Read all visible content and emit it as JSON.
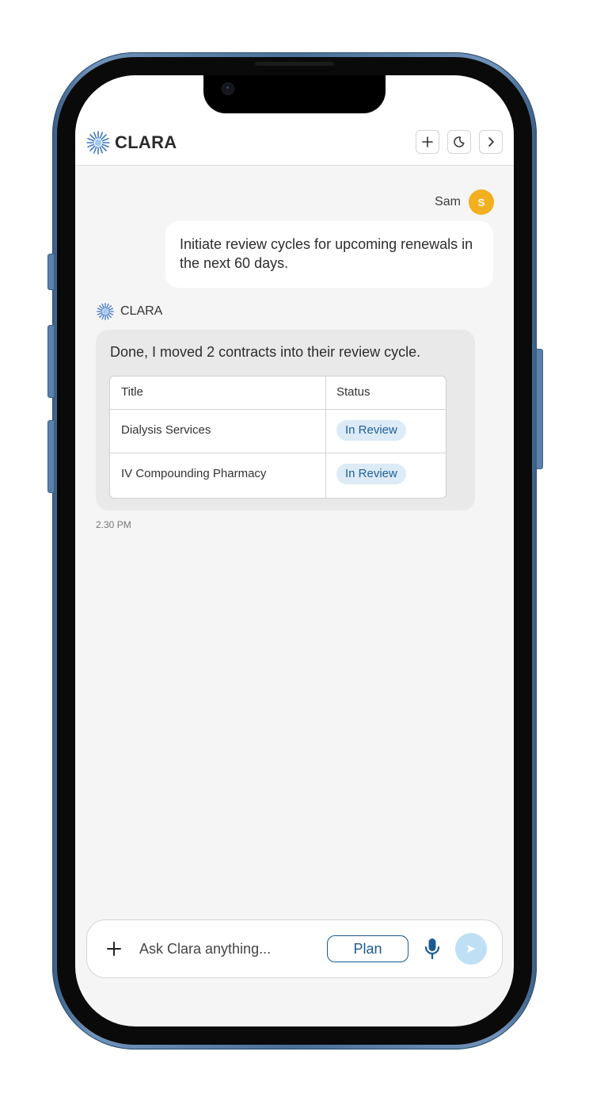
{
  "header": {
    "brand": "CLARA",
    "buttons": {
      "new_chat_icon": "plus-icon",
      "theme_icon": "moon-icon",
      "collapse_icon": "chevron-right-icon"
    }
  },
  "conversation": {
    "user": {
      "name": "Sam",
      "avatar_initial": "S",
      "avatar_color": "#F2B01E",
      "message": "Initiate review cycles for upcoming renewals in the next 60 days."
    },
    "assistant": {
      "name": "CLARA",
      "message": "Done, I moved 2 contracts into their review cycle.",
      "table": {
        "columns": [
          "Title",
          "Status"
        ],
        "rows": [
          {
            "title": "Dialysis Services",
            "status": "In Review"
          },
          {
            "title": "IV Compounding Pharmacy",
            "status": "In Review"
          }
        ]
      },
      "timestamp": "2.30 PM"
    }
  },
  "composer": {
    "placeholder": "Ask Clara anything...",
    "plan_label": "Plan",
    "icons": {
      "add": "plus-icon",
      "mic": "microphone-icon",
      "send": "send-icon"
    }
  },
  "colors": {
    "accent": "#1C5A93",
    "status_pill_bg": "#DCEBF6",
    "send_button_bg": "#BFE0F4"
  }
}
